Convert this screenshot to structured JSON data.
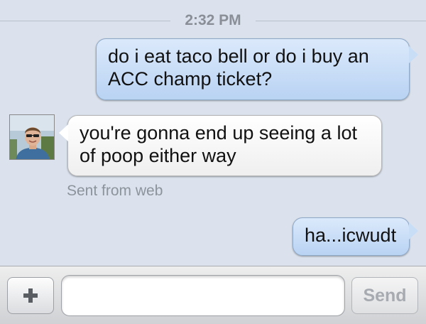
{
  "conversation": {
    "timestamp": "2:32 PM",
    "messages": [
      {
        "direction": "outgoing",
        "text_line1": "do i eat taco bell or do i buy an",
        "text_line2": "ACC champ ticket?"
      },
      {
        "direction": "incoming",
        "text_line1": "you're gonna end up seeing a lot",
        "text_line2": "of poop either way",
        "footer": "Sent from web"
      },
      {
        "direction": "outgoing",
        "text_line1": "ha...icwudt"
      }
    ]
  },
  "composer": {
    "add_icon": "plus-icon",
    "input_value": "",
    "send_label": "Send"
  },
  "colors": {
    "background": "#dbe2ed",
    "outgoing_bubble": "#c8ddf6",
    "incoming_bubble": "#ffffff",
    "timestamp_text": "#8a8f97"
  }
}
